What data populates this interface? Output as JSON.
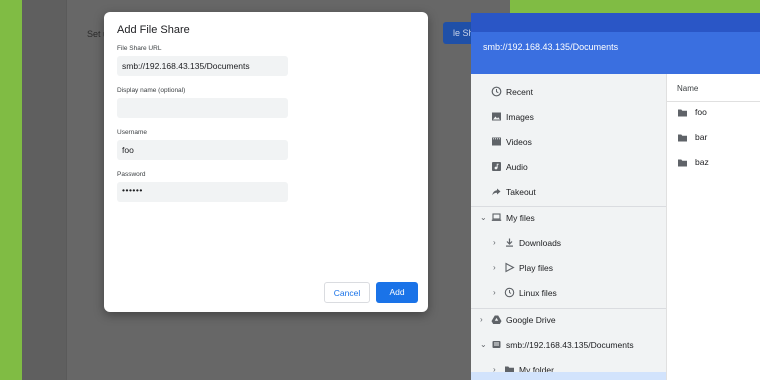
{
  "background": {
    "settings_text": "Set up or m",
    "settings_button": "le Share"
  },
  "dialog": {
    "title": "Add File Share",
    "fields": [
      {
        "label": "File Share URL",
        "value": "smb://192.168.43.135/Documents"
      },
      {
        "label": "Display name (optional)",
        "value": ""
      },
      {
        "label": "Username",
        "value": "foo"
      },
      {
        "label": "Password",
        "value": "••••••"
      }
    ],
    "cancel_label": "Cancel",
    "add_label": "Add"
  },
  "files_app": {
    "path": "smb://192.168.43.135/Documents",
    "nav": [
      {
        "label": "Recent",
        "icon": "clock-icon"
      },
      {
        "label": "Images",
        "icon": "image-icon"
      },
      {
        "label": "Videos",
        "icon": "video-icon"
      },
      {
        "label": "Audio",
        "icon": "audio-icon"
      },
      {
        "label": "Takeout",
        "icon": "share-arrow-icon"
      },
      {
        "label": "My files",
        "icon": "laptop-icon"
      },
      {
        "label": "Downloads",
        "icon": "download-icon"
      },
      {
        "label": "Play files",
        "icon": "play-icon"
      },
      {
        "label": "Linux files",
        "icon": "linux-icon"
      },
      {
        "label": "Google Drive",
        "icon": "drive-icon"
      },
      {
        "label": "smb://192.168.43.135/Documents",
        "icon": "network-share-icon"
      },
      {
        "label": "My folder",
        "icon": "folder-icon"
      }
    ],
    "list_header": "Name",
    "files": [
      {
        "name": "foo"
      },
      {
        "name": "bar"
      },
      {
        "name": "baz"
      }
    ]
  },
  "colors": {
    "accent": "#1a73e8",
    "header": "#3a6fe0",
    "wallpaper": "#80bc44"
  }
}
